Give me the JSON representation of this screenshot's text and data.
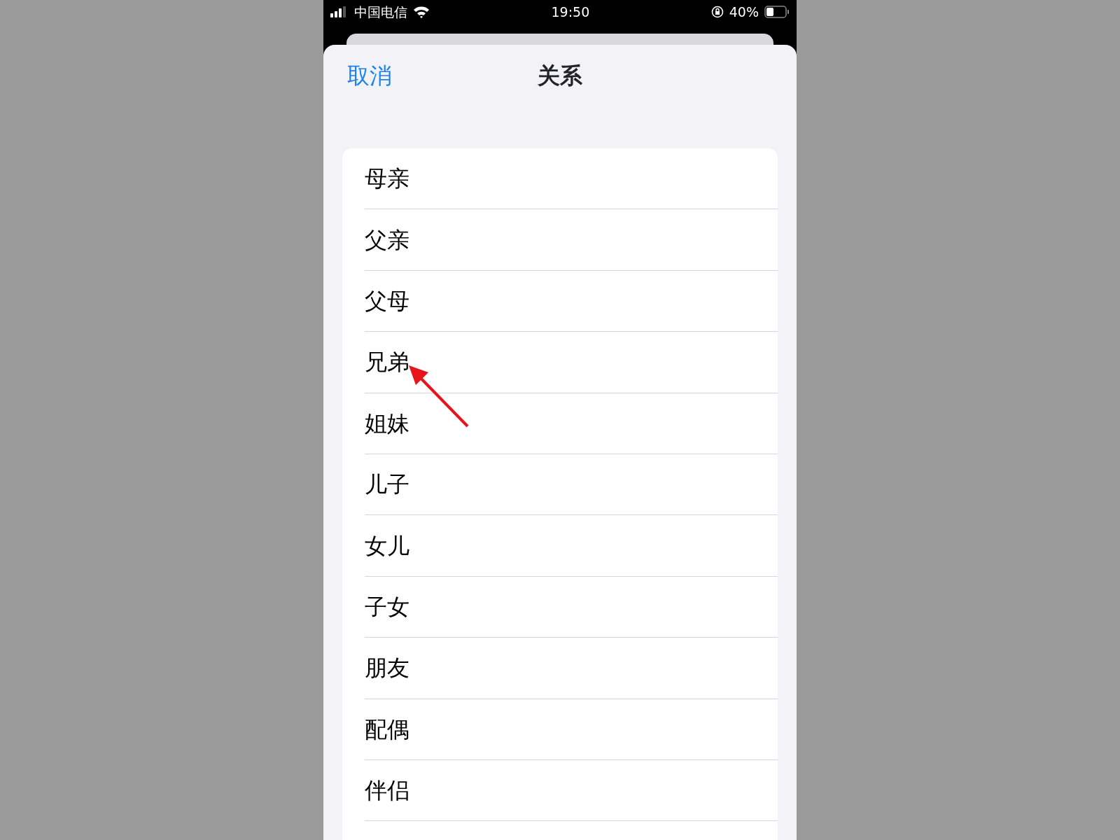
{
  "status_bar": {
    "carrier": "中国电信",
    "time": "19:50",
    "battery_percent": "40%"
  },
  "nav": {
    "cancel": "取消",
    "title": "关系"
  },
  "items": [
    {
      "label": "母亲"
    },
    {
      "label": "父亲"
    },
    {
      "label": "父母"
    },
    {
      "label": "兄弟",
      "annotated": true
    },
    {
      "label": "姐妹"
    },
    {
      "label": "儿子"
    },
    {
      "label": "女儿"
    },
    {
      "label": "子女"
    },
    {
      "label": "朋友"
    },
    {
      "label": "配偶"
    },
    {
      "label": "伴侣"
    }
  ]
}
